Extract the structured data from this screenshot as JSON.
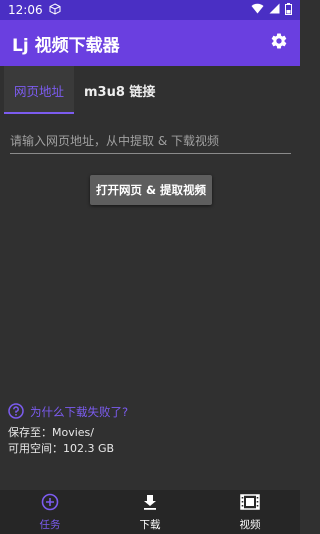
{
  "status_bar": {
    "time": "12:06",
    "icons": [
      "cube-icon",
      "wifi-icon",
      "signal-icon",
      "battery-icon"
    ]
  },
  "app_bar": {
    "title": "Lj 视频下载器",
    "settings_icon": "gear-icon"
  },
  "tabs": [
    {
      "label": "网页地址",
      "active": true
    },
    {
      "label": "m3u8 链接",
      "active": false
    }
  ],
  "url_input": {
    "placeholder": "请输入网页地址，从中提取 & 下载视频",
    "value": ""
  },
  "open_button": {
    "label": "打开网页 & 提取视频"
  },
  "help": {
    "icon": "help-circle-icon",
    "label": "为什么下载失败了?"
  },
  "storage": {
    "save_to": "保存至：Movies/",
    "free_space": "可用空间：102.3 GB"
  },
  "bottom_nav": [
    {
      "label": "任务",
      "icon": "add-circle-icon",
      "active": true
    },
    {
      "label": "下载",
      "icon": "download-icon",
      "active": false
    },
    {
      "label": "视频",
      "icon": "film-icon",
      "active": false
    }
  ],
  "colors": {
    "accent": "#7c5cf0",
    "app_bar": "#6a3fe0",
    "status_bar": "#4a2fc4",
    "background": "#303030"
  }
}
